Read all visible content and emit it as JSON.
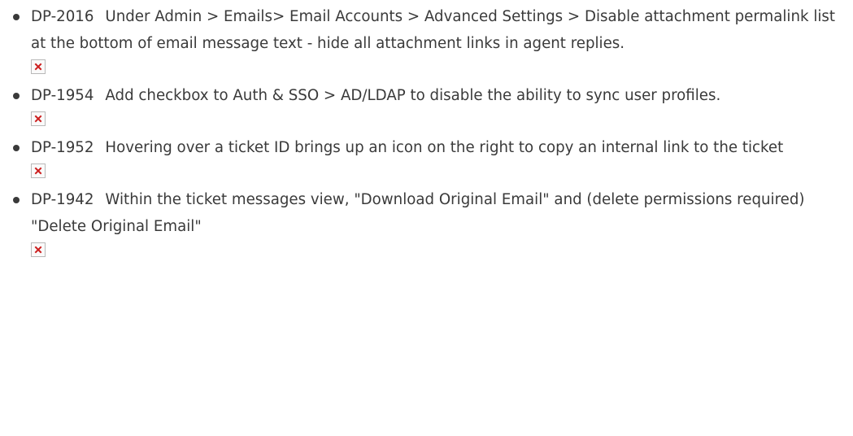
{
  "items": [
    {
      "id": "DP-2016",
      "text": "Under Admin > Emails> Email Accounts > Advanced Settings > Disable attachment permalink list at the bottom of email message text - hide all attachment links in agent replies.",
      "image_icon": "broken-image-icon"
    },
    {
      "id": "DP-1954",
      "text": "Add checkbox to Auth & SSO > AD/LDAP to disable the ability to sync user profiles.",
      "image_icon": "broken-image-icon"
    },
    {
      "id": "DP-1952",
      "text": "Hovering over a ticket ID brings up an icon on the right to copy an internal link to the ticket",
      "image_icon": "broken-image-icon"
    },
    {
      "id": "DP-1942",
      "text": "Within the ticket messages view, \"Download Original Email\" and (delete permissions required) \"Delete Original Email\"",
      "image_icon": "broken-image-icon"
    }
  ],
  "colors": {
    "text": "#3a3a3a",
    "broken_icon_x": "#cc1f1f",
    "broken_icon_border": "#b9b9b9"
  }
}
